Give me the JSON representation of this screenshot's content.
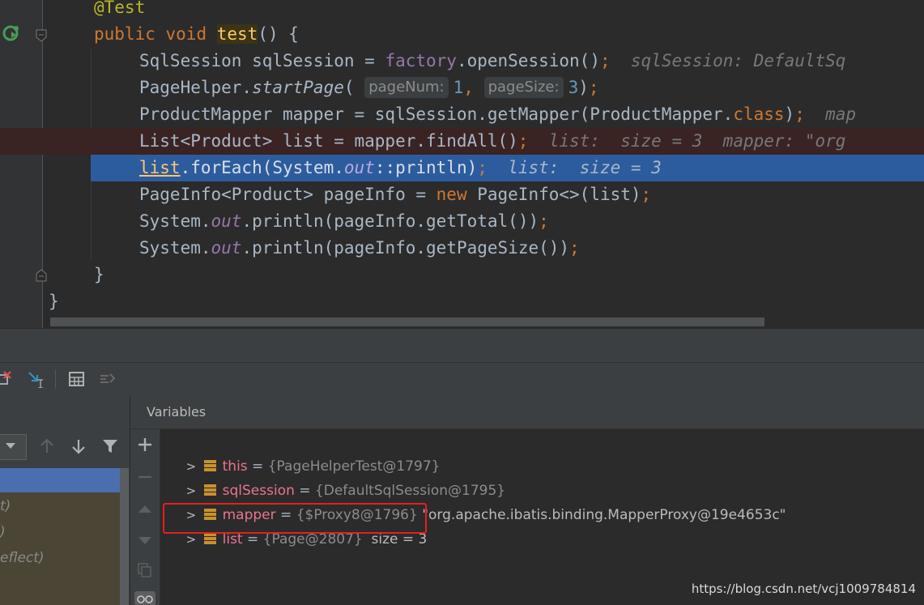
{
  "editor": {
    "lines": [
      {
        "annotation": "@Test"
      },
      {
        "kw1": "public",
        "kw2": "void",
        "method": "test",
        "rest": "() {"
      },
      {
        "decl": "SqlSession sqlSession = ",
        "field": "factory",
        "call": ".openSession()",
        "semi": ";",
        "hint": "sqlSession: DefaultSq"
      },
      {
        "cls": "PageHelper.",
        "method": "startPage",
        "open": "(",
        "p1name": "pageNum:",
        "p1val": "1",
        "comma": ",",
        "p2name": "pageSize:",
        "p2val": "3",
        "close": ")",
        "semi": ";"
      },
      {
        "decl": "ProductMapper mapper = sqlSession.getMapper(ProductMapper.",
        "kw": "class",
        "close": ")",
        "semi": ";",
        "hint": "map"
      },
      {
        "decl": "List<Product> list = mapper.findAll()",
        "semi": ";",
        "hint": "list:  size = 3  mapper: \"org"
      },
      {
        "var": "list",
        "rest1": ".forEach(System.",
        "field": "out",
        "rest2": "::println)",
        "semi": ";",
        "hint": "list:  size = 3"
      },
      {
        "decl": "PageInfo<Product> pageInfo = ",
        "kw": "new",
        "rest": " PageInfo<>(list)",
        "semi": ";"
      },
      {
        "pre": "System.",
        "field": "out",
        "rest": ".println(pageInfo.getTotal())",
        "semi": ";"
      },
      {
        "pre": "System.",
        "field": "out",
        "rest": ".println(pageInfo.getPageSize())",
        "semi": ";"
      },
      {
        "brace": "}"
      },
      {
        "brace": "}"
      }
    ]
  },
  "variables_panel": {
    "title": "Variables",
    "items": [
      {
        "name": "this",
        "eq": " = ",
        "ref": "{PageHelperTest@1797}",
        "extra": ""
      },
      {
        "name": "sqlSession",
        "eq": " = ",
        "ref": "{DefaultSqlSession@1795}",
        "extra": ""
      },
      {
        "name": "mapper",
        "eq": " = ",
        "ref": "{$Proxy8@1796}",
        "extra": " \"org.apache.ibatis.binding.MapperProxy@19e4653c\""
      },
      {
        "name": "list",
        "eq": " = ",
        "ref": "{Page@2807}",
        "extra": "  size = 3"
      }
    ]
  },
  "frames_panel": {
    "items": [
      {
        "label": "t)"
      },
      {
        "label": ")"
      },
      {
        "label": "eflect)"
      }
    ]
  },
  "watermark": "https://blog.csdn.net/vcj1009784814",
  "colors": {
    "exec_line": "#2d5c9e",
    "breakpoint_line": "#3a2323",
    "highlight_box": "#e3211c"
  }
}
